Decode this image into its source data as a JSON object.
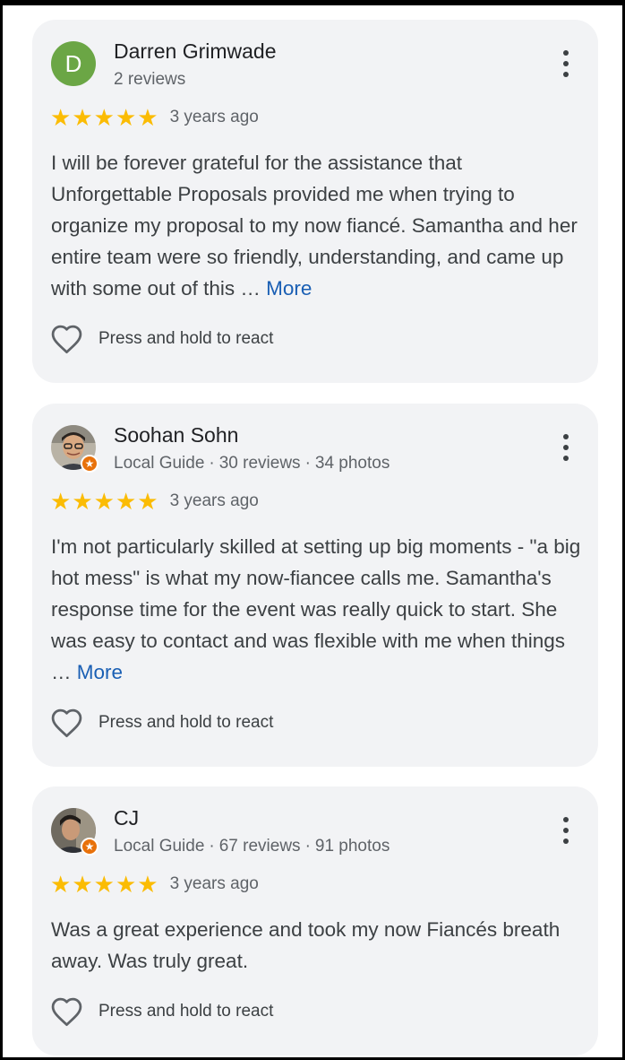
{
  "reviews": [
    {
      "name": "Darren Grimwade",
      "avatar_letter": "D",
      "meta": [
        "2 reviews"
      ],
      "stars": 5,
      "date": "3 years ago",
      "body": "I will be forever grateful for the assistance that Unforgettable Proposals provided me when trying to organize my proposal to my now fiancé. Samantha and her entire team were so friendly, understanding, and came up with some out of this …",
      "more_label": "More",
      "react_label": "Press and hold to react"
    },
    {
      "name": "Soohan Sohn",
      "meta": [
        "Local Guide",
        "30 reviews",
        "34 photos"
      ],
      "stars": 5,
      "date": "3 years ago",
      "body": "I'm not particularly skilled at setting up big moments - \"a big hot mess\" is what my now-fiancee calls me. Samantha's response time for the event was really quick to start. She was easy to contact and was flexible with me when things …",
      "more_label": "More",
      "react_label": "Press and hold to react"
    },
    {
      "name": "CJ",
      "meta": [
        "Local Guide",
        "67 reviews",
        "91 photos"
      ],
      "stars": 5,
      "date": "3 years ago",
      "body": "Was a great experience and took my now Fiancés breath away. Was truly great.",
      "react_label": "Press and hold to react"
    }
  ],
  "icons": {
    "star": "star-icon",
    "heart": "heart-outline-icon",
    "menu": "more-vert-icon",
    "badge": "local-guide-badge-icon"
  },
  "colors": {
    "star": "#fbbc04",
    "link": "#1a5fb4",
    "card_bg": "#f2f3f5",
    "avatar_green": "#6ba645",
    "guide_orange": "#e8710a"
  }
}
